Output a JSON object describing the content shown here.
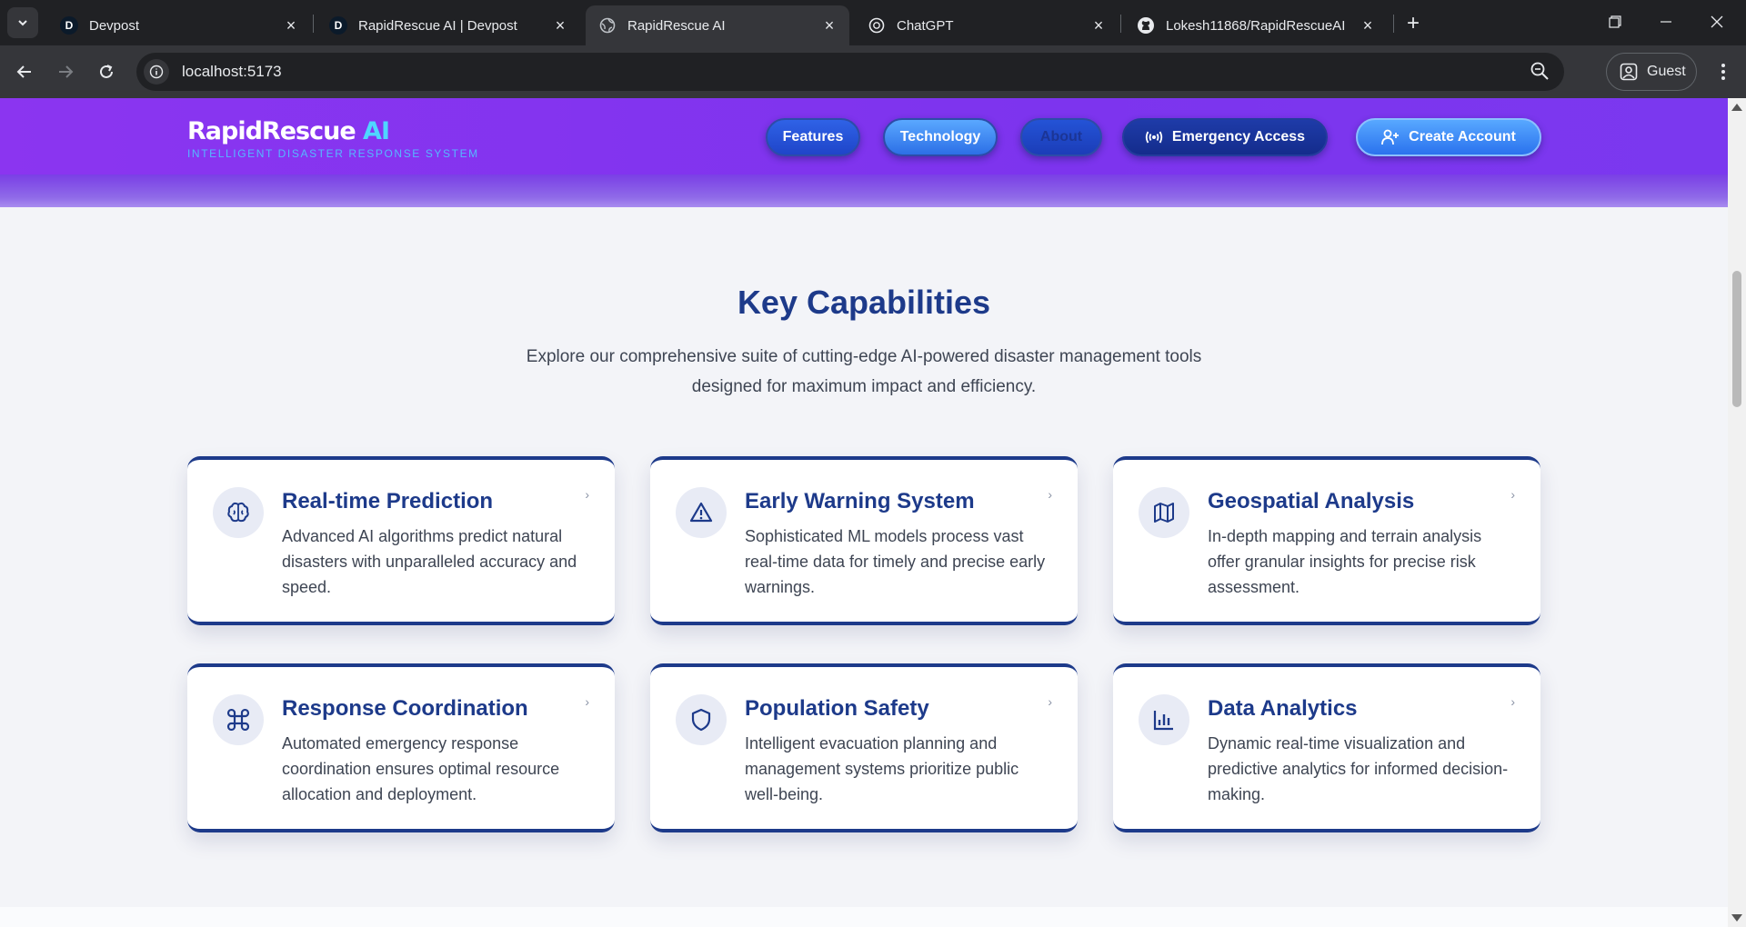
{
  "browser": {
    "tabs": [
      {
        "title": "Devpost",
        "favicon": "devpost-icon",
        "active": false
      },
      {
        "title": "RapidRescue AI | Devpost",
        "favicon": "devpost-icon",
        "active": false
      },
      {
        "title": "RapidRescue AI",
        "favicon": "globe-icon",
        "active": true
      },
      {
        "title": "ChatGPT",
        "favicon": "chatgpt-icon",
        "active": false
      },
      {
        "title": "Lokesh11868/RapidRescueAI",
        "favicon": "github-icon",
        "active": false
      }
    ],
    "favicon_letter": "D",
    "url": "localhost:5173",
    "profile_label": "Guest"
  },
  "header": {
    "logo_main": "RapidRescue",
    "logo_accent": "AI",
    "logo_tagline": "INTELLIGENT DISASTER RESPONSE SYSTEM",
    "nav": {
      "features": "Features",
      "technology": "Technology",
      "about": "About",
      "emergency": "Emergency Access",
      "create": "Create Account"
    }
  },
  "capabilities": {
    "title": "Key Capabilities",
    "subtitle": "Explore our comprehensive suite of cutting-edge AI-powered disaster management tools designed for maximum impact and efficiency.",
    "cards": [
      {
        "icon": "brain-icon",
        "title": "Real-time Prediction",
        "desc": "Advanced AI algorithms predict natural disasters with unparalleled accuracy and speed."
      },
      {
        "icon": "warning-icon",
        "title": "Early Warning System",
        "desc": "Sophisticated ML models process vast real-time data for timely and precise early warnings."
      },
      {
        "icon": "map-icon",
        "title": "Geospatial Analysis",
        "desc": "In-depth mapping and terrain analysis offer granular insights for precise risk assessment."
      },
      {
        "icon": "command-icon",
        "title": "Response Coordination",
        "desc": "Automated emergency response coordination ensures optimal resource allocation and deployment."
      },
      {
        "icon": "shield-icon",
        "title": "Population Safety",
        "desc": "Intelligent evacuation planning and management systems prioritize public well-being."
      },
      {
        "icon": "bar-chart-icon",
        "title": "Data Analytics",
        "desc": "Dynamic real-time visualization and predictive analytics for informed decision-making."
      }
    ]
  },
  "colors": {
    "header_purple": "#8b35f0",
    "title_navy": "#1d3a8a",
    "accent_cyan": "#4fd6ff"
  }
}
